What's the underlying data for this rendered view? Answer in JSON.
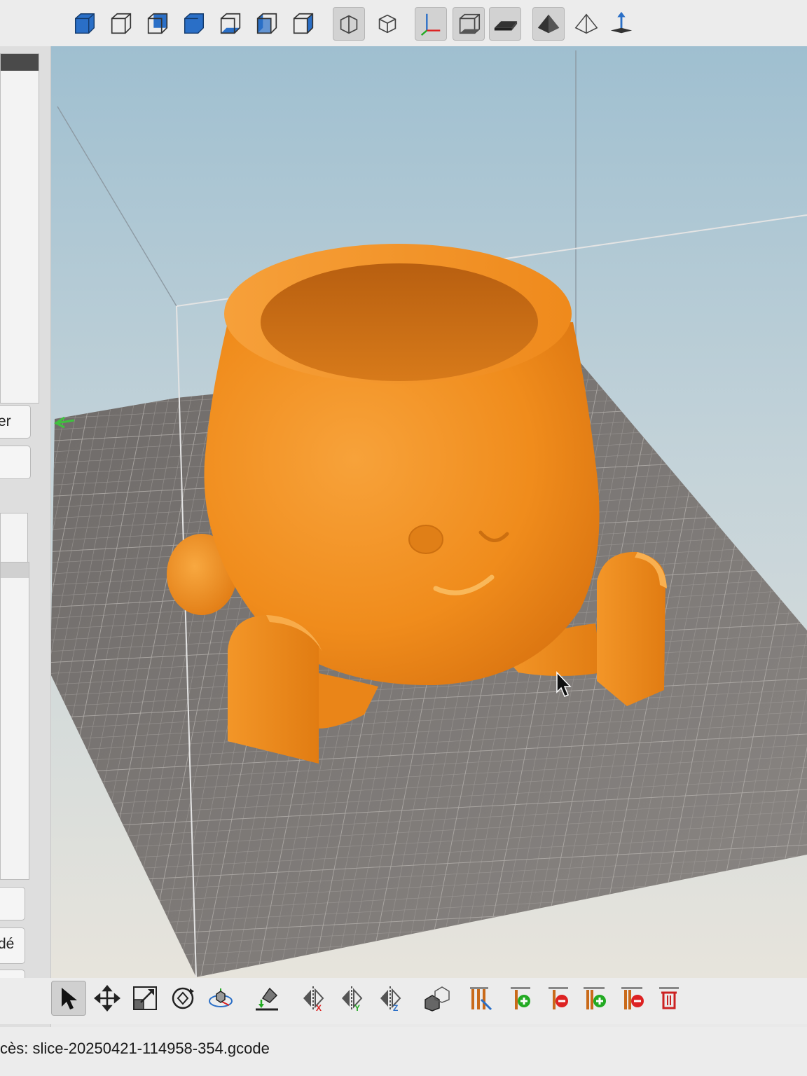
{
  "left_panel": {
    "button_1_label": "er",
    "button_2_label": "dé"
  },
  "status": {
    "message": "cès: slice-20250421-114958-354.gcode"
  },
  "toolbar_top": {
    "icons": [
      "iso-view-icon",
      "front-view-icon",
      "back-view-icon",
      "top-view-icon",
      "bottom-view-icon",
      "left-view-icon",
      "right-view-icon",
      "perspective-icon",
      "orthographic-icon",
      "axes-icon",
      "bed-icon",
      "plate-icon",
      "solid-shade-icon",
      "wireframe-shade-icon",
      "reset-orientation-icon"
    ]
  },
  "toolbar_bottom": {
    "icons": [
      "select-arrow-icon",
      "move-icon",
      "scale-icon",
      "rotate-icon",
      "rotate-3d-icon",
      "lay-flat-icon",
      "mirror-x-icon",
      "mirror-y-icon",
      "mirror-z-icon",
      "split-object-icon",
      "support-edit-icon",
      "add-support-icon",
      "remove-support-icon",
      "add-all-supports-icon",
      "remove-all-supports-icon",
      "delete-icon"
    ]
  },
  "colors": {
    "model": "#f28c1c",
    "bed": "#7a7674",
    "sky_top": "#9fbfd0",
    "sky_bottom": "#e7e4dc"
  }
}
